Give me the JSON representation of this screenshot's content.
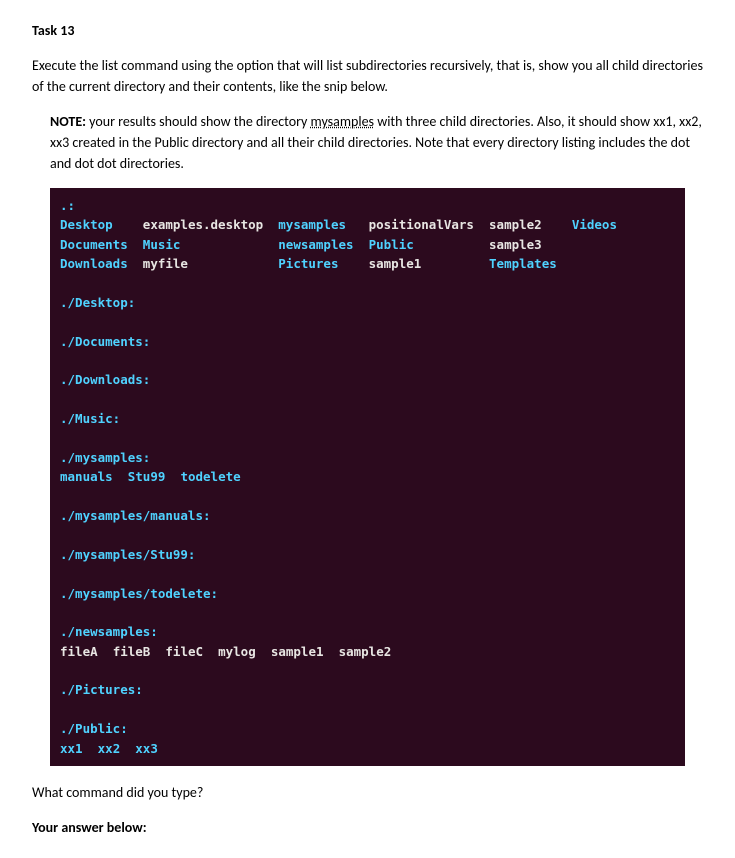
{
  "task": {
    "title": "Task 13",
    "instruction": "Execute the list command using the option that will list subdirectories recursively, that is, show you all child directories of the current directory and their contents, like the snip below.",
    "note_label": "NOTE:",
    "note_part1": " your results should show the directory ",
    "note_underlined": "mysamples",
    "note_part2": " with three child directories. Also, it should show xx1, xx2, xx3 created in the Public directory and all their child directories. Note that every directory listing includes the dot and dot dot directories."
  },
  "terminal": {
    "root_header": ".:",
    "root_row1": {
      "c1": "Desktop",
      "c2": "examples.desktop",
      "c3": "mysamples",
      "c4": "positionalVars",
      "c5": "sample2",
      "c6": "Videos"
    },
    "root_row2": {
      "c1": "Documents",
      "c2": "Music",
      "c3": "newsamples",
      "c4": "Public",
      "c5": "sample3"
    },
    "root_row3": {
      "c1": "Downloads",
      "c2": "myfile",
      "c3": "Pictures",
      "c4": "sample1",
      "c5": "Templates"
    },
    "desktop_header": "./Desktop:",
    "documents_header": "./Documents:",
    "downloads_header": "./Downloads:",
    "music_header": "./Music:",
    "mysamples_header": "./mysamples:",
    "mysamples_items": {
      "i1": "manuals",
      "i2": "Stu99",
      "i3": "todelete"
    },
    "mysamples_manuals_header": "./mysamples/manuals:",
    "mysamples_stu99_header": "./mysamples/Stu99:",
    "mysamples_todelete_header": "./mysamples/todelete:",
    "newsamples_header": "./newsamples:",
    "newsamples_items": {
      "i1": "fileA",
      "i2": "fileB",
      "i3": "fileC",
      "i4": "mylog",
      "i5": "sample1",
      "i6": "sample2"
    },
    "pictures_header": "./Pictures:",
    "public_header": "./Public:",
    "public_items": {
      "i1": "xx1",
      "i2": "xx2",
      "i3": "xx3"
    }
  },
  "question": "What command did you type?",
  "answer_label": "Your answer below:"
}
